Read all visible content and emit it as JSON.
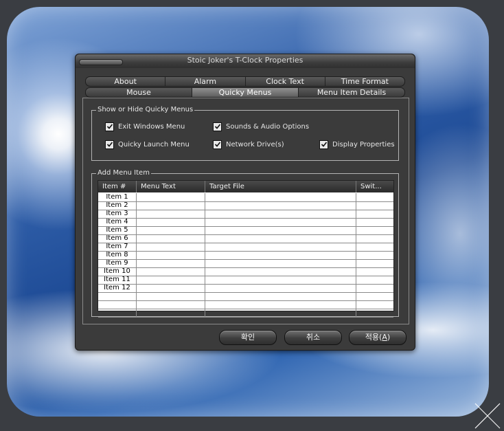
{
  "window": {
    "title": "Stoic Joker's T-Clock Properties"
  },
  "tabs": {
    "row1": [
      "About",
      "Alarm",
      "Clock Text",
      "Time Format"
    ],
    "row2": [
      "Mouse",
      "Quicky Menus",
      "Menu Item Details"
    ],
    "active": "Quicky Menus"
  },
  "show_hide_group": {
    "title": "Show or Hide Quicky Menus",
    "options": [
      {
        "label": "Exit Windows Menu",
        "checked": true
      },
      {
        "label": "Sounds & Audio Options",
        "checked": true
      },
      {
        "label": "Quicky Launch Menu",
        "checked": true
      },
      {
        "label": "Network Drive(s)",
        "checked": true
      },
      {
        "label": "Display Properties",
        "checked": true
      }
    ]
  },
  "add_menu_group": {
    "title": "Add Menu Item",
    "columns": [
      "Item #",
      "Menu Text",
      "Target File",
      "Swit..."
    ],
    "rows": [
      "Item 1",
      "Item 2",
      "Item 3",
      "Item 4",
      "Item 5",
      "Item 6",
      "Item 7",
      "Item 8",
      "Item 9",
      "Item 10",
      "Item 11",
      "Item 12"
    ]
  },
  "buttons": {
    "ok": "확인",
    "cancel": "취소",
    "apply": "적용(A)"
  },
  "colors": {
    "window_bg": "#3b3b3b",
    "accent_tab": "#7a7a7a"
  }
}
